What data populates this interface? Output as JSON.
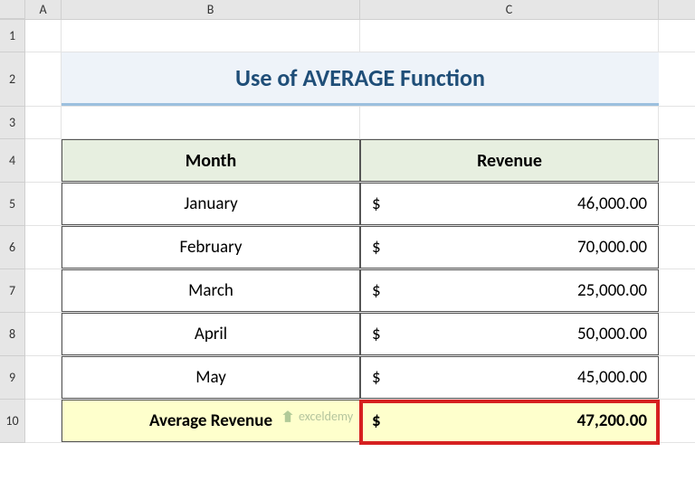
{
  "columns": {
    "A": "A",
    "B": "B",
    "C": "C"
  },
  "rows": {
    "r1": "1",
    "r2": "2",
    "r3": "3",
    "r4": "4",
    "r5": "5",
    "r6": "6",
    "r7": "7",
    "r8": "8",
    "r9": "9",
    "r10": "10"
  },
  "title": "Use of AVERAGE Function",
  "headers": {
    "month": "Month",
    "revenue": "Revenue"
  },
  "currency": "$",
  "data": [
    {
      "month": "January",
      "revenue": "46,000.00"
    },
    {
      "month": "February",
      "revenue": "70,000.00"
    },
    {
      "month": "March",
      "revenue": "25,000.00"
    },
    {
      "month": "April",
      "revenue": "50,000.00"
    },
    {
      "month": "May",
      "revenue": "45,000.00"
    }
  ],
  "average": {
    "label": "Average Revenue",
    "value": "47,200.00"
  },
  "watermark": "exceldemy"
}
